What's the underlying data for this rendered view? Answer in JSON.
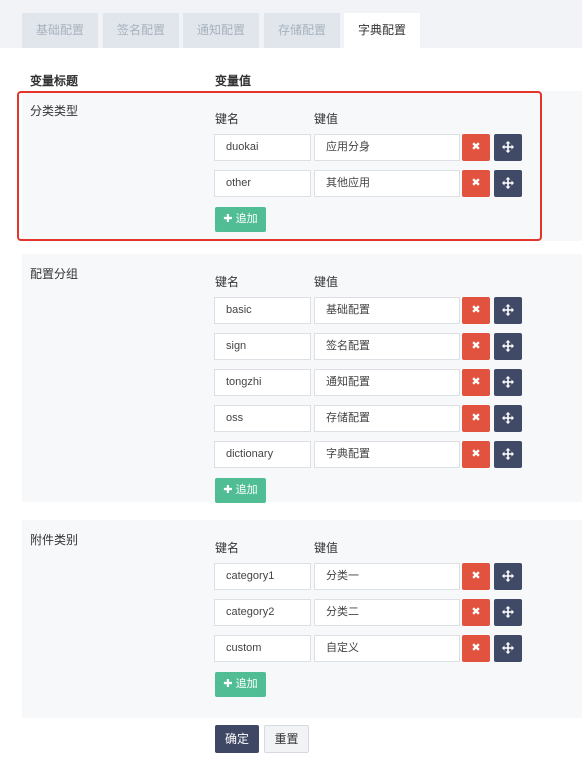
{
  "tabs": [
    "基础配置",
    "签名配置",
    "通知配置",
    "存储配置",
    "字典配置"
  ],
  "active_tab": "字典配置",
  "headers": {
    "title": "变量标题",
    "value": "变量值"
  },
  "sections": [
    {
      "title": "分类类型",
      "key_header": "键名",
      "value_header": "键值",
      "rows": [
        {
          "key": "duokai",
          "value": "应用分身"
        },
        {
          "key": "other",
          "value": "其他应用"
        }
      ],
      "add_label": "追加"
    },
    {
      "title": "配置分组",
      "key_header": "键名",
      "value_header": "键值",
      "rows": [
        {
          "key": "basic",
          "value": "基础配置"
        },
        {
          "key": "sign",
          "value": "签名配置"
        },
        {
          "key": "tongzhi",
          "value": "通知配置"
        },
        {
          "key": "oss",
          "value": "存储配置"
        },
        {
          "key": "dictionary",
          "value": "字典配置"
        }
      ],
      "add_label": "追加"
    },
    {
      "title": "附件类别",
      "key_header": "键名",
      "value_header": "键值",
      "rows": [
        {
          "key": "category1",
          "value": "分类一"
        },
        {
          "key": "category2",
          "value": "分类二"
        },
        {
          "key": "custom",
          "value": "自定义"
        }
      ],
      "add_label": "追加"
    }
  ],
  "actions": {
    "confirm": "确定",
    "reset": "重置"
  },
  "colors": {
    "delete": "#e2533f",
    "move": "#404a66",
    "add": "#51bd95",
    "highlight": "#e3352a"
  }
}
